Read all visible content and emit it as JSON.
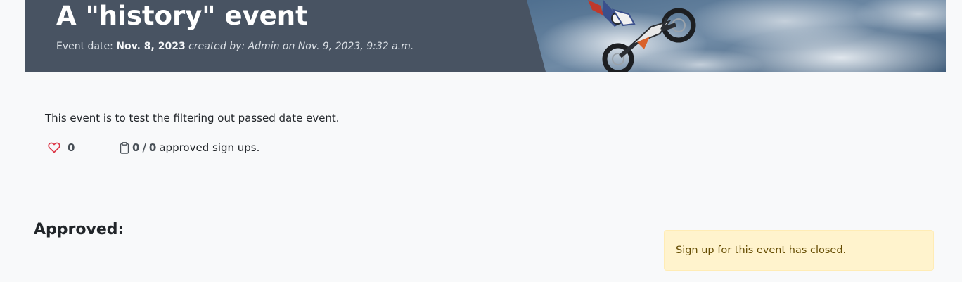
{
  "event": {
    "title": "A \"history\" event",
    "meta": {
      "date_label": "Event date:",
      "date_value": "Nov. 8, 2023",
      "created_text": "created by: Admin on Nov. 9, 2023, 9:32 a.m."
    },
    "description": "This event is to test the filtering out passed date event.",
    "likes": {
      "icon": "heart-outline-icon",
      "count": "0"
    },
    "signups": {
      "icon": "clipboard-icon",
      "approved": "0",
      "separator": "/",
      "total": "0",
      "suffix": "approved sign ups."
    }
  },
  "approved_section": {
    "heading": "Approved:"
  },
  "alert": {
    "message": "Sign up for this event has closed."
  },
  "colors": {
    "hero_background": "#485362",
    "alert_background": "#fff3cd",
    "heart": "#dc3545"
  }
}
